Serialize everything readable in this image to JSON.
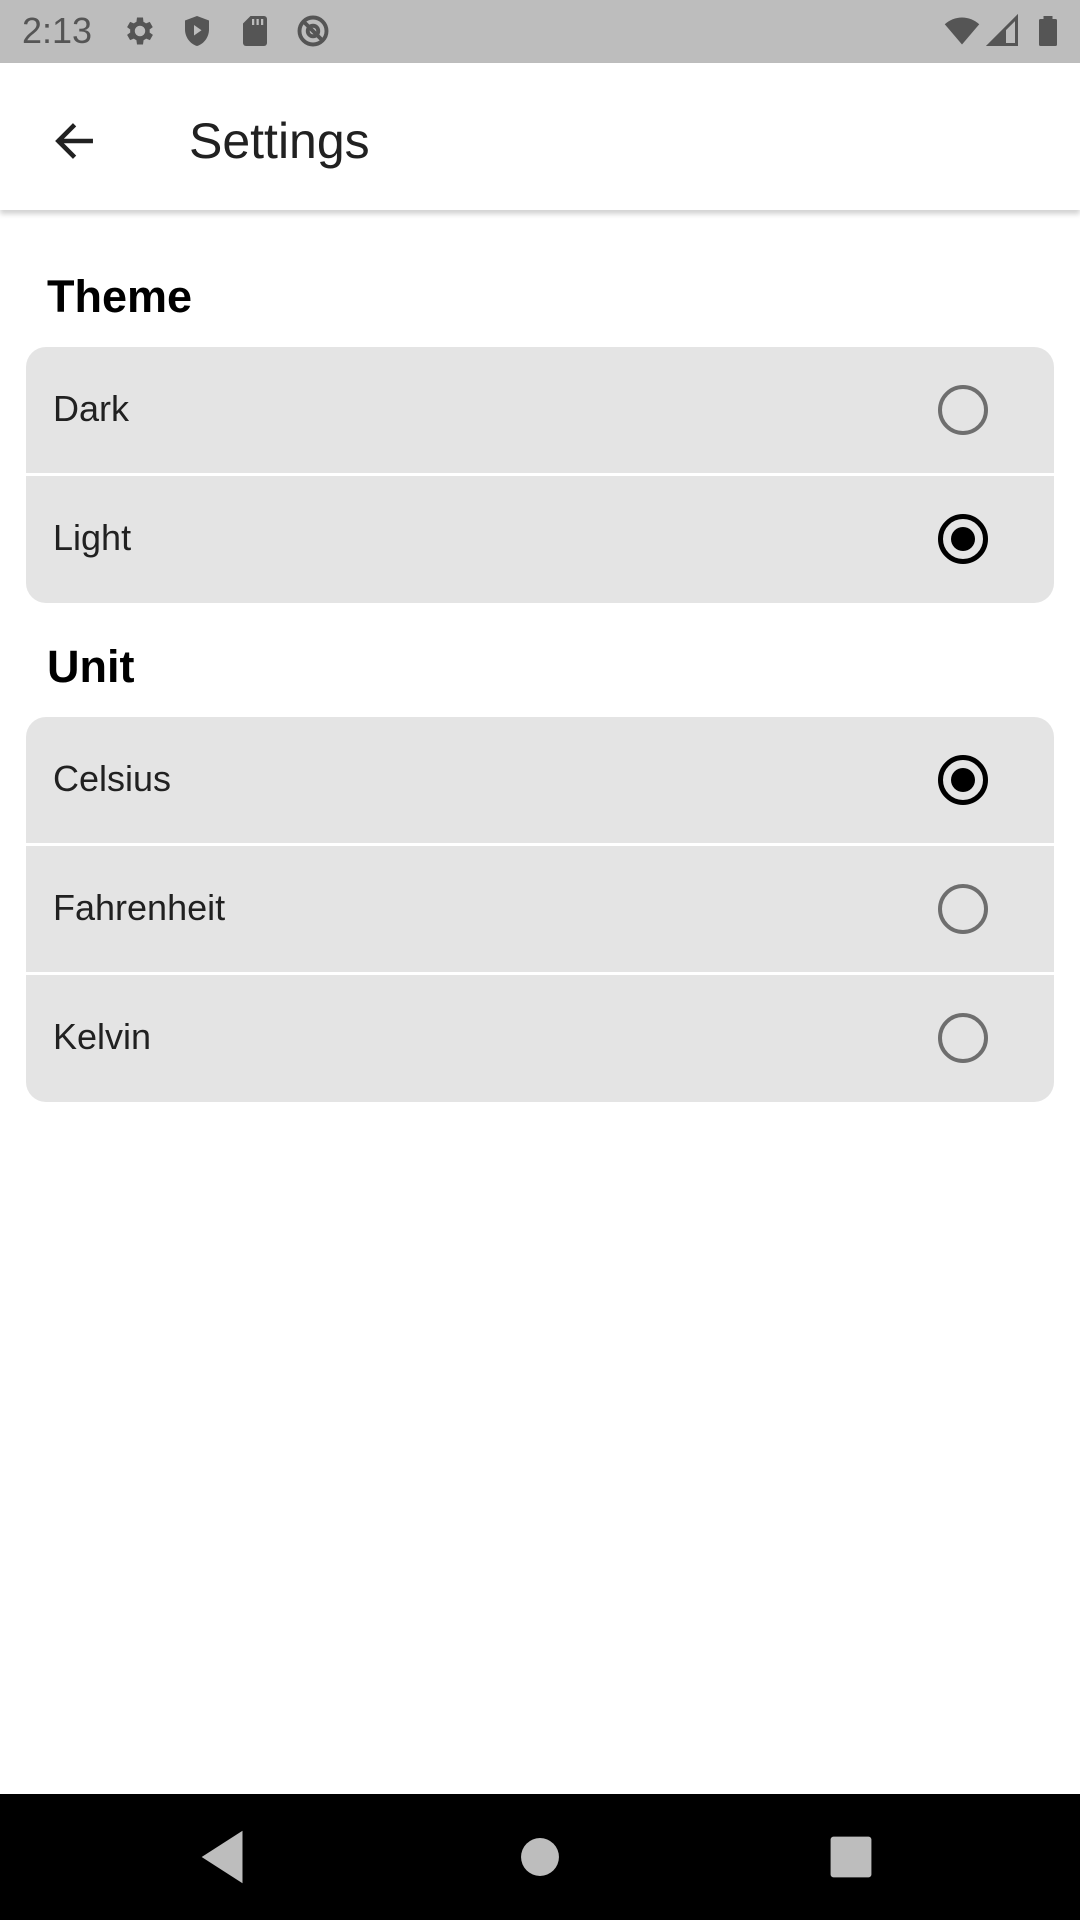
{
  "status_bar": {
    "time": "2:13",
    "left_icons": [
      "gear-icon",
      "shield-play-icon",
      "sd-card-icon",
      "at-sign-icon"
    ],
    "right_icons": [
      "wifi-icon",
      "cell-signal-icon",
      "battery-icon"
    ]
  },
  "app_bar": {
    "back_icon": "arrow-left-icon",
    "title": "Settings"
  },
  "sections": [
    {
      "title": "Theme",
      "options": [
        {
          "label": "Dark",
          "selected": false
        },
        {
          "label": "Light",
          "selected": true
        }
      ]
    },
    {
      "title": "Unit",
      "options": [
        {
          "label": "Celsius",
          "selected": true
        },
        {
          "label": "Fahrenheit",
          "selected": false
        },
        {
          "label": "Kelvin",
          "selected": false
        }
      ]
    }
  ],
  "nav_bar": {
    "icons": [
      "back-triangle-icon",
      "home-circle-icon",
      "recents-square-icon"
    ]
  },
  "colors": {
    "status_bar_bg": "#bdbdbd",
    "group_bg": "#e4e4e4",
    "radio_checked": "#000000",
    "radio_unchecked": "#6e6e6e",
    "nav_bar_bg": "#000000"
  }
}
